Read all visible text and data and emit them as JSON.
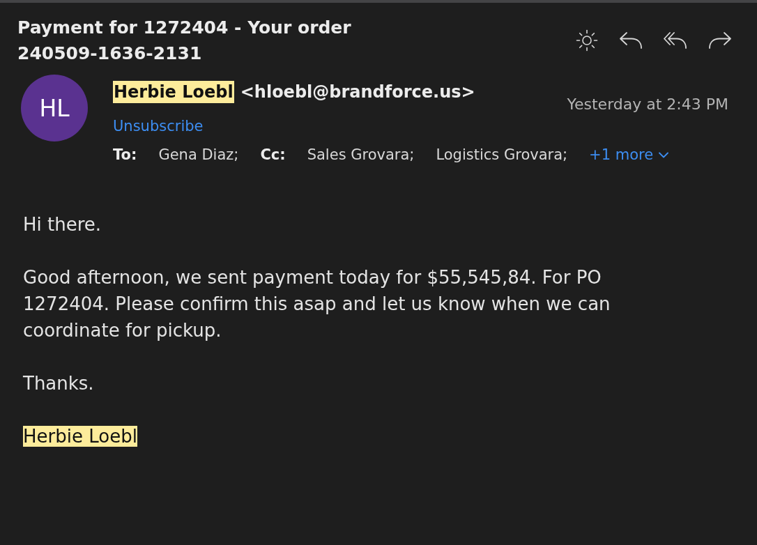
{
  "message": {
    "subject": "Payment for 1272404 - Your order 240509-1636-2131",
    "sender": {
      "initials": "HL",
      "name": "Herbie Loebl",
      "highlighted": true,
      "address": "<hloebl@brandforce.us>",
      "unsubscribe": "Unsubscribe"
    },
    "date": "Yesterday at 2:43 PM",
    "recipients": {
      "to_label": "To:",
      "to": [
        "Gena Diaz;"
      ],
      "cc_label": "Cc:",
      "cc": [
        "Sales Grovara;",
        "Logistics Grovara;"
      ],
      "more": "+1 more"
    },
    "body": [
      {
        "text": "Hi there.",
        "highlighted": false
      },
      {
        "text": "Good afternoon, we sent payment today for $55,545,84. For PO 1272404. Please confirm this asap and let us know when we can coordinate for pickup.",
        "highlighted": false
      },
      {
        "text": "Thanks.",
        "highlighted": false
      },
      {
        "text": "Herbie Loebl",
        "highlighted": true
      }
    ]
  }
}
